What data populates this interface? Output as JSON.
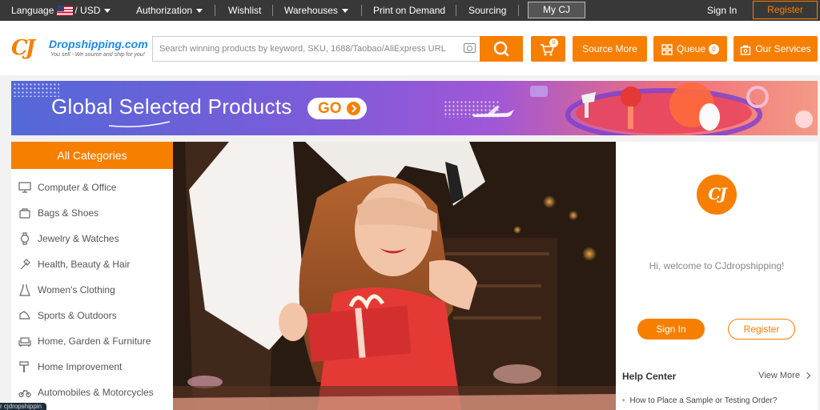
{
  "topbar": {
    "language_label": "Language",
    "currency": "/ USD",
    "authorization": "Authorization",
    "wishlist": "Wishlist",
    "warehouses": "Warehouses",
    "print_on_demand": "Print on Demand",
    "sourcing": "Sourcing",
    "my_cj": "My CJ",
    "sign_in": "Sign In",
    "register": "Register"
  },
  "header": {
    "logo_mark": "CJ",
    "logo_text": "Dropshipping.com",
    "logo_tagline": "You sell - We source and ship for you!",
    "search_placeholder": "Search winning products by keyword, SKU, 1688/Taobao/AliExpress URL",
    "search_value": "",
    "cart_count": "0",
    "source_more": "Source More",
    "queue_label": "Queue",
    "queue_count": "0",
    "our_services": "Our Services"
  },
  "banner": {
    "title": "Global Selected Products",
    "go": "GO"
  },
  "categories": {
    "heading": "All Categories",
    "items": [
      {
        "label": "Computer & Office",
        "icon": "computer-icon"
      },
      {
        "label": "Bags & Shoes",
        "icon": "bag-icon"
      },
      {
        "label": "Jewelry & Watches",
        "icon": "watch-icon"
      },
      {
        "label": "Health, Beauty & Hair",
        "icon": "beauty-icon"
      },
      {
        "label": "Women's Clothing",
        "icon": "dress-icon"
      },
      {
        "label": "Sports & Outdoors",
        "icon": "sports-icon"
      },
      {
        "label": "Home, Garden & Furniture",
        "icon": "sofa-icon"
      },
      {
        "label": "Home Improvement",
        "icon": "hammer-icon"
      },
      {
        "label": "Automobiles & Motorcycles",
        "icon": "motorcycle-icon"
      }
    ]
  },
  "panel": {
    "avatar_text": "CJ",
    "welcome": "Hi, welcome to CJdropshipping!",
    "sign_in": "Sign In",
    "register": "Register",
    "help_center": "Help Center",
    "view_more": "View More",
    "help_items": [
      "How to Place a Sample or Testing Order?"
    ]
  },
  "status_bar": {
    "url": "r cjdropshippin"
  },
  "colors": {
    "accent": "#f77f00",
    "topbar": "#383838"
  }
}
